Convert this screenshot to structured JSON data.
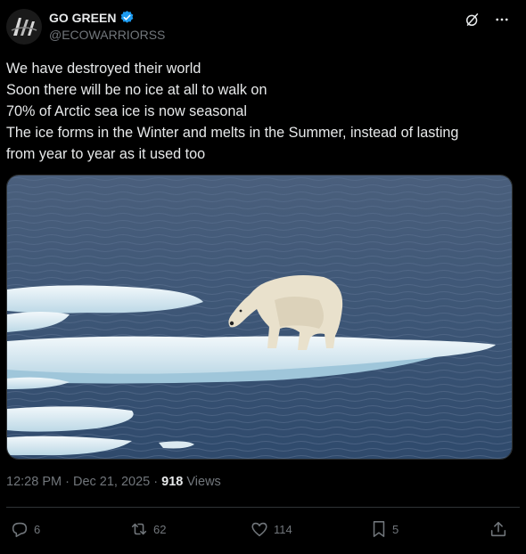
{
  "author": {
    "name": "GO GREEN",
    "handle": "@ECOWARRIORSS",
    "verified_color": "#1d9bf0"
  },
  "post": {
    "lines": [
      "We have destroyed their world",
      "Soon there will be no ice at all to walk on",
      "70% of Arctic sea ice is now seasonal",
      "The ice forms in the Winter and melts in the Summer, instead of lasting",
      "from year to year as it used too"
    ],
    "media_icon": "polar-bear-on-ice-floe-photo"
  },
  "meta": {
    "time": "12:28 PM",
    "separator": "·",
    "date": "Dec 21, 2025",
    "views_count": "918",
    "views_label": "Views"
  },
  "actions": {
    "replies": "6",
    "reposts": "62",
    "likes": "114",
    "bookmarks": "5"
  },
  "colors": {
    "background": "#000000",
    "text": "#e7e9ea",
    "muted": "#71767b",
    "border": "#2f3336"
  }
}
